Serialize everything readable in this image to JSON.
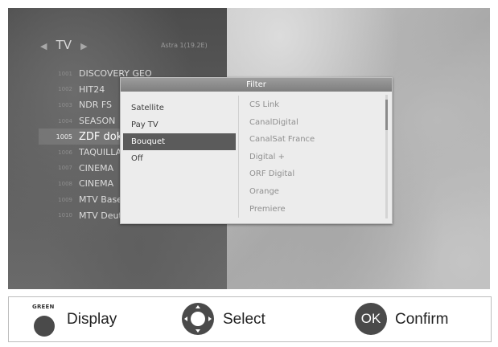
{
  "channel_list": {
    "title": "TV",
    "satellite_label": "Astra 1(19.2E)",
    "channels": [
      {
        "number": "1001",
        "name": "DISCOVERY GEO",
        "selected": false
      },
      {
        "number": "1002",
        "name": "HIT24",
        "selected": false
      },
      {
        "number": "1003",
        "name": "NDR FS",
        "selected": false
      },
      {
        "number": "1004",
        "name": "SEASON",
        "selected": false
      },
      {
        "number": "1005",
        "name": "ZDF doku",
        "selected": true
      },
      {
        "number": "1006",
        "name": "TAQUILLA",
        "selected": false
      },
      {
        "number": "1007",
        "name": "CINEMA",
        "selected": false
      },
      {
        "number": "1008",
        "name": "CINEMA",
        "selected": false
      },
      {
        "number": "1009",
        "name": "MTV Base",
        "selected": false
      },
      {
        "number": "1010",
        "name": "MTV Deutschland",
        "selected": false
      }
    ]
  },
  "filter_popup": {
    "title": "Filter",
    "options": [
      {
        "label": "Satellite",
        "selected": false
      },
      {
        "label": "Pay TV",
        "selected": false
      },
      {
        "label": "Bouquet",
        "selected": true
      },
      {
        "label": "Off",
        "selected": false
      }
    ],
    "values": [
      "CS Link",
      "CanalDigital",
      "CanalSat France",
      "Digital +",
      "ORF Digital",
      "Orange",
      "Premiere"
    ]
  },
  "legend": {
    "green_key_text": "GREEN",
    "display_label": "Display",
    "select_label": "Select",
    "ok_key_text": "OK",
    "confirm_label": "Confirm"
  },
  "colors": {
    "selection": "#5b5b5b",
    "popup_title_bar": "#8c8c8c",
    "key_fill": "#4a4a4a"
  }
}
